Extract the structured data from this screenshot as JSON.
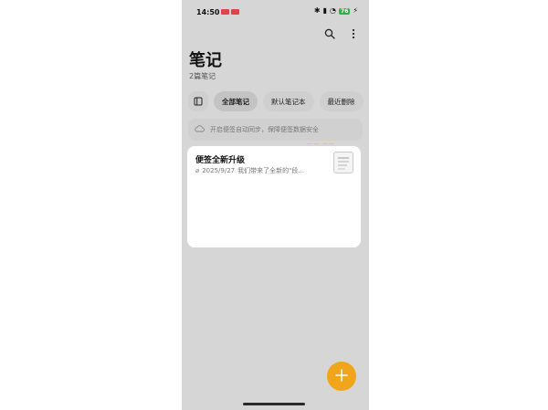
{
  "status_bar": {
    "time": "14:50",
    "battery": "76",
    "badge_color": "#e0424a",
    "battery_color": "#2fb14a"
  },
  "header": {
    "title": "笔记",
    "subtitle": "2篇笔记",
    "search_icon": "search-icon",
    "more_icon": "more-vertical-icon"
  },
  "tabs": {
    "sidebar_toggle_icon": "sidebar-toggle-icon",
    "items": [
      {
        "label": "全部笔记",
        "active": true
      },
      {
        "label": "默认笔记本",
        "active": false
      },
      {
        "label": "最近删除",
        "active": false
      }
    ]
  },
  "sync_banner": {
    "icon": "cloud-icon",
    "text": "开启便签自动同步，保障便签数据安全"
  },
  "notes": [
    {
      "title": "便签全新升级",
      "meta_icon": "attachment-icon",
      "date": "2025/9/27",
      "preview": "我们带来了全新的\"段..."
    }
  ],
  "fab": {
    "icon": "plus-icon",
    "color": "#f0a51a"
  }
}
